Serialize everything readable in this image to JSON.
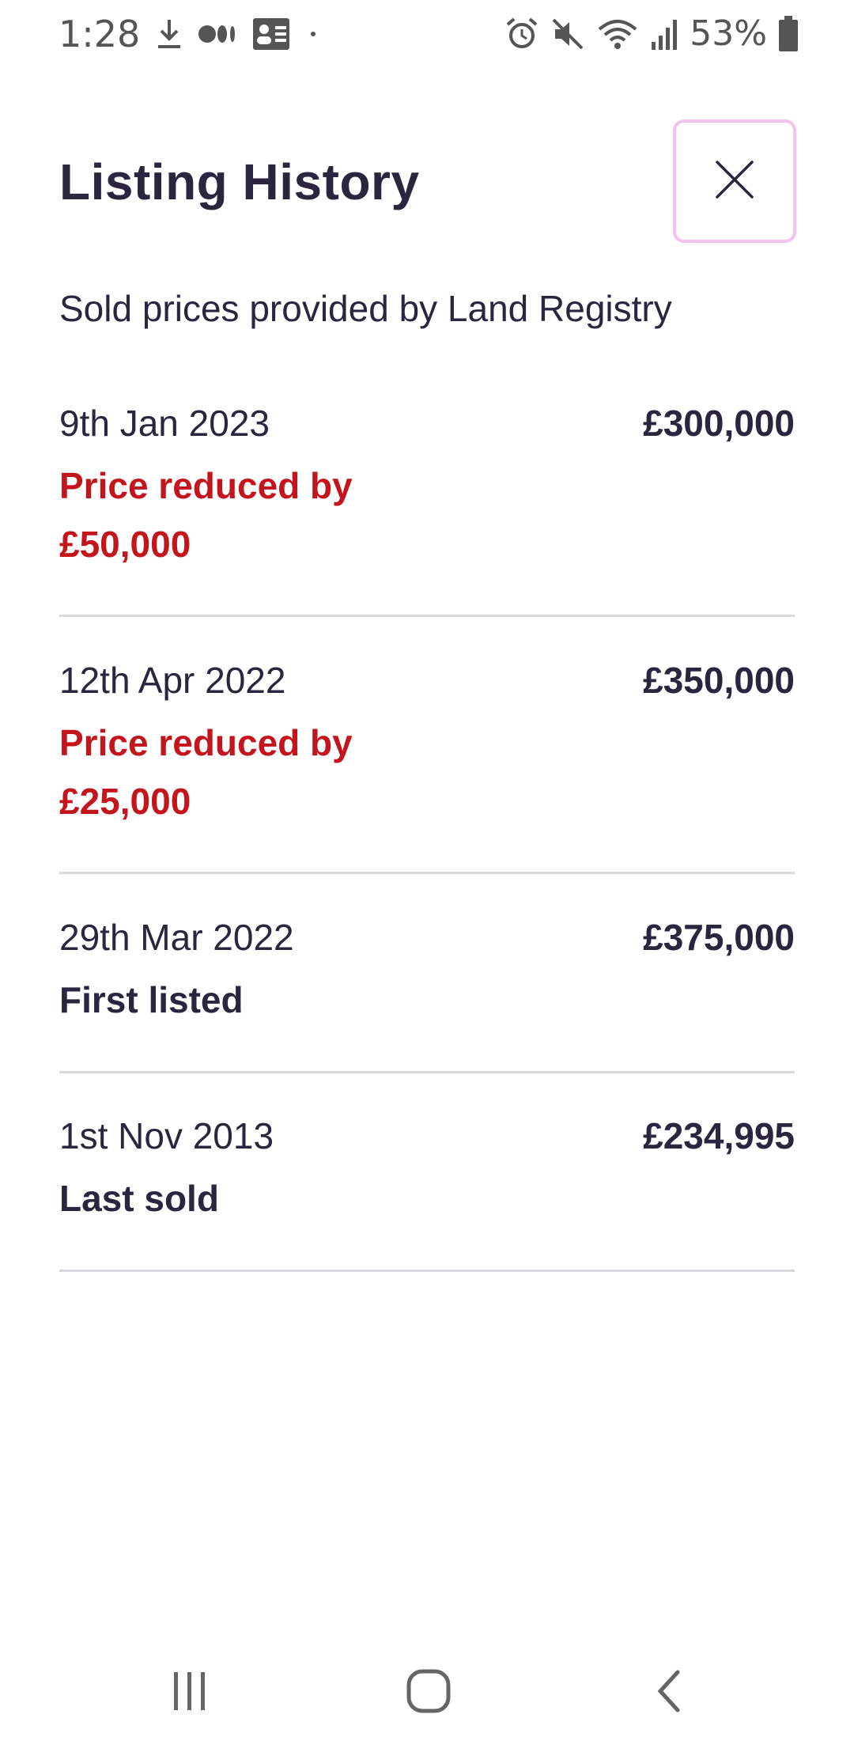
{
  "status_bar": {
    "time": "1:28",
    "battery_percent": "53%",
    "left_icons": [
      "download-icon",
      "media-icon",
      "contacts-icon",
      "dot-icon"
    ],
    "right_icons": [
      "alarm-icon",
      "mute-icon",
      "wifi-icon",
      "signal-icon",
      "battery-icon"
    ]
  },
  "header": {
    "title": "Listing History",
    "close_icon": "close-icon"
  },
  "subtitle": "Sold prices provided by Land Registry",
  "history": [
    {
      "date": "9th Jan 2023",
      "price": "£300,000",
      "event": "Price reduced by £50,000",
      "event_type": "reduced"
    },
    {
      "date": "12th Apr 2022",
      "price": "£350,000",
      "event": "Price reduced by £25,000",
      "event_type": "reduced"
    },
    {
      "date": "29th Mar 2022",
      "price": "£375,000",
      "event": "First listed",
      "event_type": "neutral"
    },
    {
      "date": "1st Nov 2013",
      "price": "£234,995",
      "event": "Last sold",
      "event_type": "neutral"
    }
  ],
  "nav_bar": {
    "recents_icon": "recents-icon",
    "home_icon": "home-icon",
    "back_icon": "back-icon"
  },
  "colors": {
    "text": "#2b2540",
    "reduced": "#c4151c",
    "close_border": "#f3c2ee",
    "divider": "#d9d9de"
  }
}
